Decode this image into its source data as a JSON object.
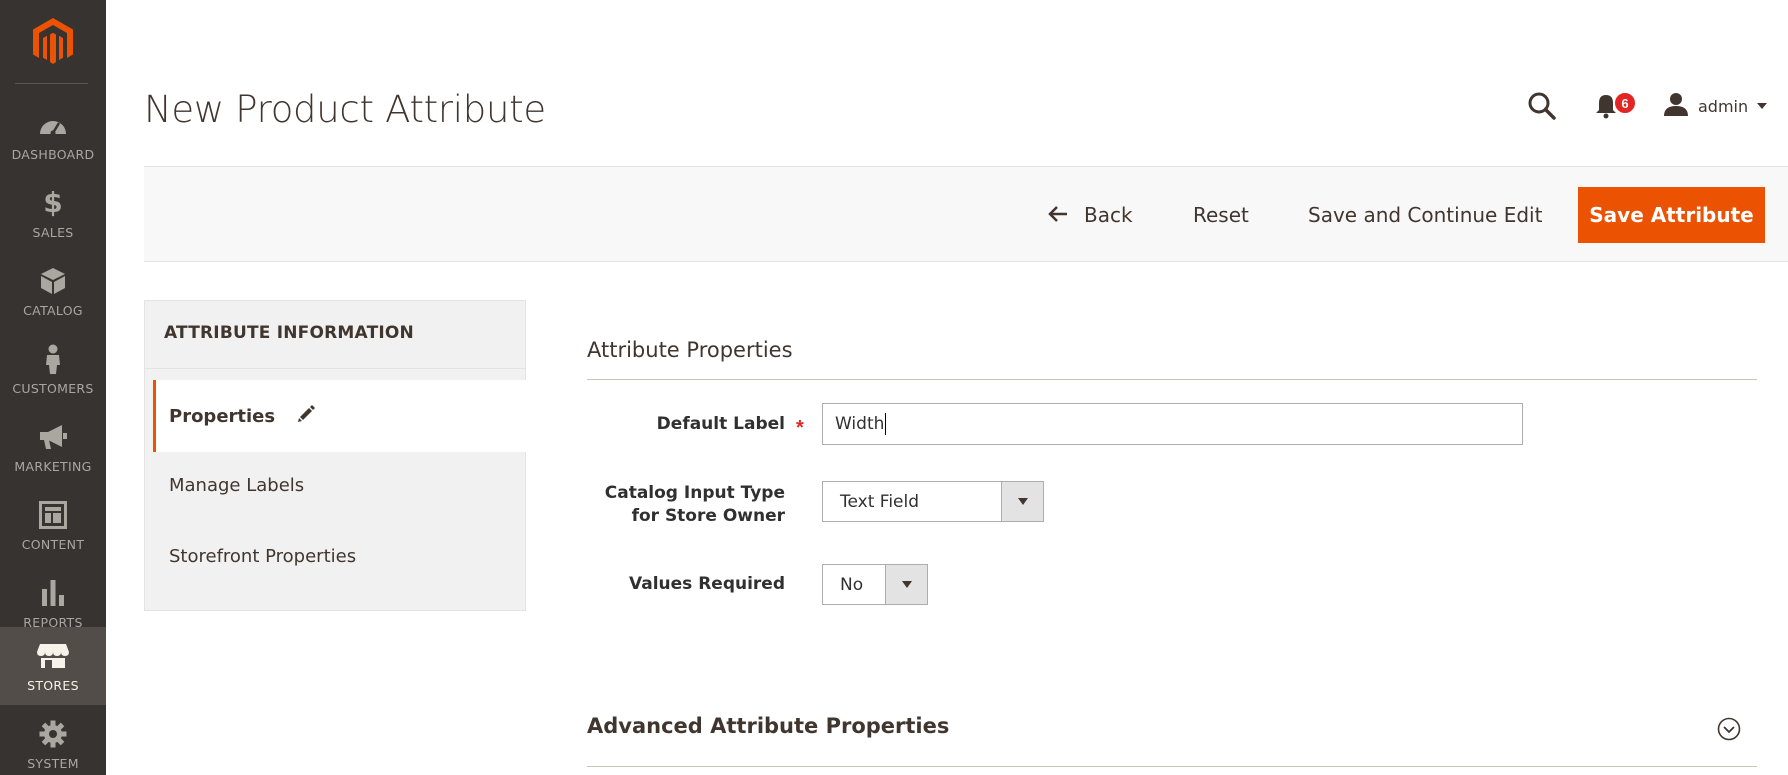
{
  "sidebar": {
    "logo_icon": "magento-logo-icon",
    "accent_color": "#eb5202",
    "items": [
      {
        "label": "DASHBOARD",
        "icon": "speedometer-icon",
        "active": false
      },
      {
        "label": "SALES",
        "icon": "dollar-icon",
        "active": false
      },
      {
        "label": "CATALOG",
        "icon": "cube-icon",
        "active": false
      },
      {
        "label": "CUSTOMERS",
        "icon": "person-icon",
        "active": false
      },
      {
        "label": "MARKETING",
        "icon": "megaphone-icon",
        "active": false
      },
      {
        "label": "CONTENT",
        "icon": "layout-icon",
        "active": false
      },
      {
        "label": "REPORTS",
        "icon": "bar-chart-icon",
        "active": false
      },
      {
        "label": "STORES",
        "icon": "storefront-icon",
        "active": true
      },
      {
        "label": "SYSTEM",
        "icon": "gear-icon",
        "active": false
      }
    ]
  },
  "header": {
    "title": "New Product Attribute",
    "notifications_count": "6",
    "user_name": "admin"
  },
  "actions": {
    "back": "Back",
    "reset": "Reset",
    "save_continue": "Save and Continue Edit",
    "save": "Save Attribute",
    "save_color": "#eb5202"
  },
  "tabs": {
    "title": "ATTRIBUTE INFORMATION",
    "items": [
      "Properties",
      "Manage Labels",
      "Storefront Properties"
    ]
  },
  "form": {
    "section_title": "Attribute Properties",
    "default_label": {
      "label": "Default Label",
      "value": "Width"
    },
    "input_type": {
      "label_line1": "Catalog Input Type",
      "label_line2": "for Store Owner",
      "value": "Text Field"
    },
    "values_required": {
      "label": "Values Required",
      "value": "No"
    },
    "advanced_title": "Advanced Attribute Properties"
  }
}
